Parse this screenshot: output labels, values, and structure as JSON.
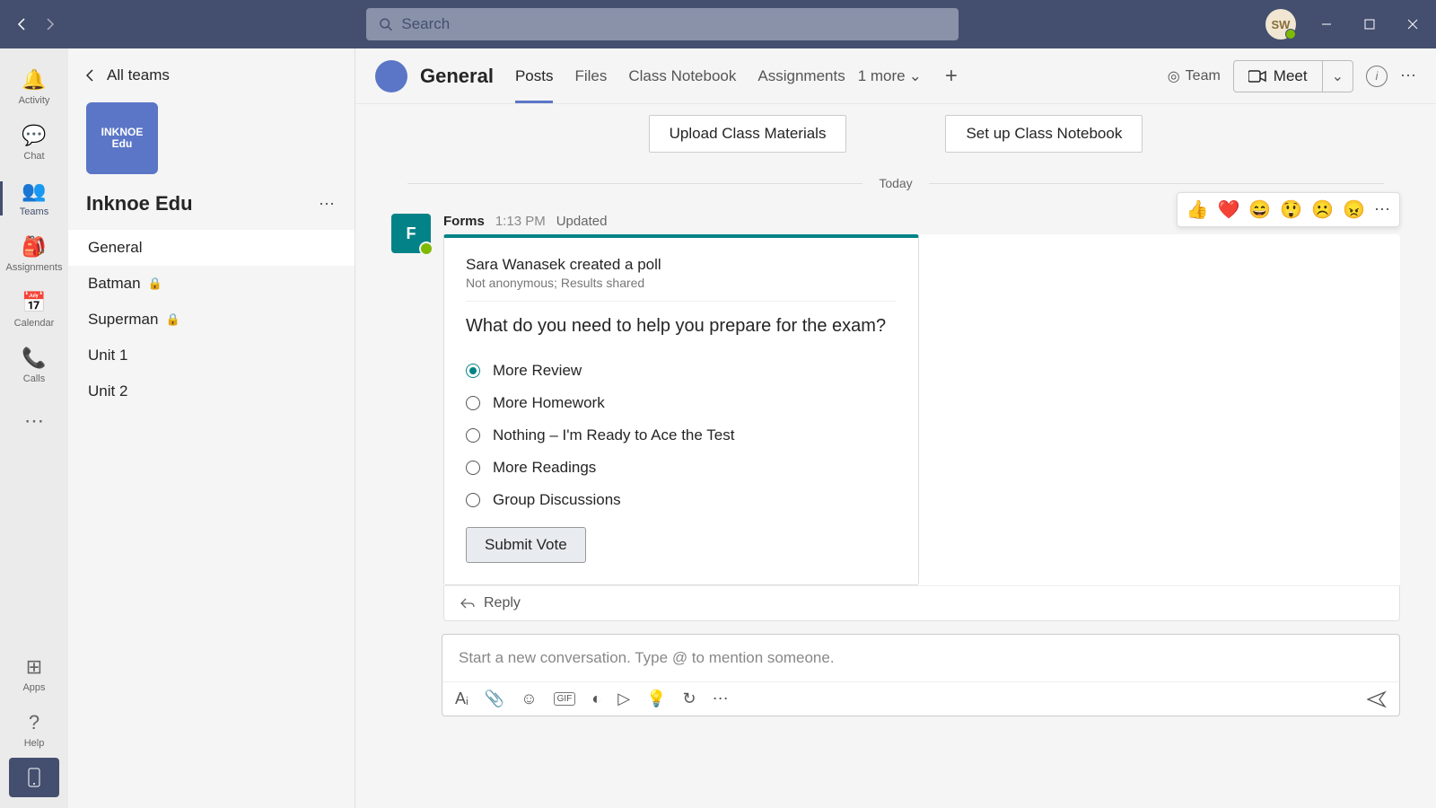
{
  "titlebar": {
    "search_placeholder": "Search",
    "avatar_initials": "SW"
  },
  "rail": {
    "activity": "Activity",
    "chat": "Chat",
    "teams": "Teams",
    "assignments": "Assignments",
    "calendar": "Calendar",
    "calls": "Calls",
    "apps": "Apps",
    "help": "Help"
  },
  "panel": {
    "back_label": "All teams",
    "team_logo_line1": "INKNOE",
    "team_logo_line2": "Edu",
    "team_name": "Inknoe Edu",
    "channels": [
      {
        "name": "General",
        "locked": false,
        "active": true
      },
      {
        "name": "Batman",
        "locked": true,
        "active": false
      },
      {
        "name": "Superman",
        "locked": true,
        "active": false
      },
      {
        "name": "Unit 1",
        "locked": false,
        "active": false
      },
      {
        "name": "Unit 2",
        "locked": false,
        "active": false
      }
    ]
  },
  "header": {
    "channel_title": "General",
    "tabs": [
      "Posts",
      "Files",
      "Class Notebook",
      "Assignments"
    ],
    "more_label": "1 more",
    "team_label": "Team",
    "meet_label": "Meet"
  },
  "actions": {
    "upload": "Upload Class Materials",
    "setup": "Set up Class Notebook"
  },
  "date_divider": "Today",
  "post": {
    "app_name": "Forms",
    "time": "1:13 PM",
    "updated": "Updated",
    "card_title": "Sara Wanasek created a poll",
    "card_subtitle": "Not anonymous; Results shared",
    "question": "What do you need to help you prepare for the exam?",
    "options": [
      {
        "label": "More Review",
        "selected": true
      },
      {
        "label": "More Homework",
        "selected": false
      },
      {
        "label": "Nothing – I'm Ready to Ace the Test",
        "selected": false
      },
      {
        "label": "More Readings",
        "selected": false
      },
      {
        "label": "Group Discussions",
        "selected": false
      }
    ],
    "submit_label": "Submit Vote",
    "reply_label": "Reply",
    "reactions": [
      "👍",
      "❤️",
      "😄",
      "😲",
      "☹️",
      "😠"
    ]
  },
  "composer": {
    "placeholder": "Start a new conversation. Type @ to mention someone."
  }
}
